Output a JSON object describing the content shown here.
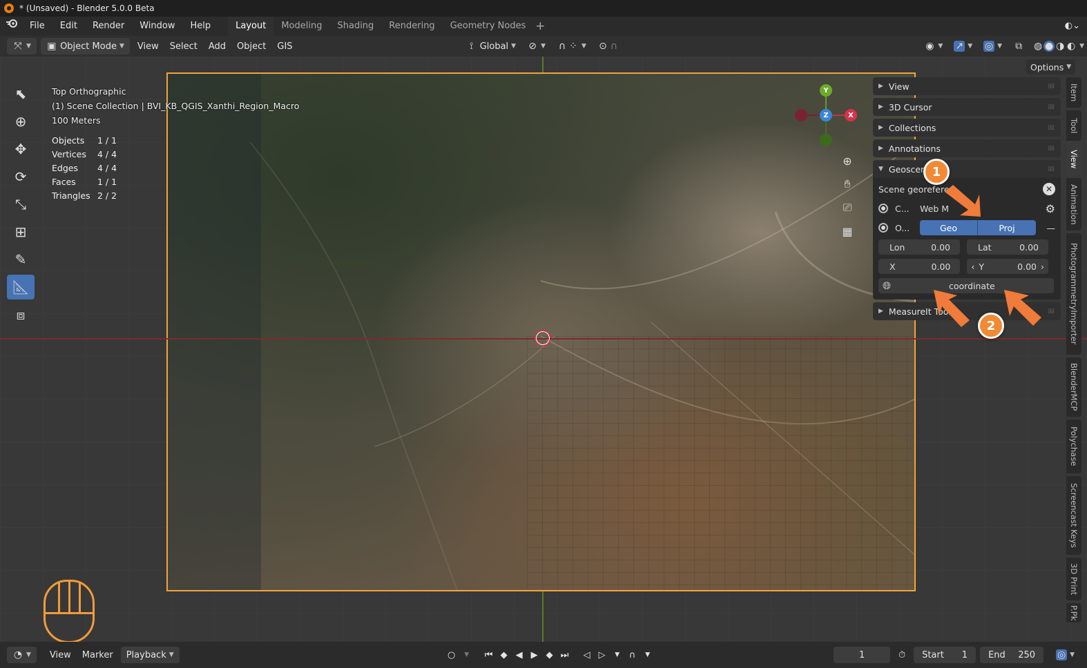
{
  "window": {
    "title": "* (Unsaved) - Blender 5.0.0 Beta"
  },
  "menu": {
    "items": [
      "File",
      "Edit",
      "Render",
      "Window",
      "Help"
    ]
  },
  "workspaces": {
    "tabs": [
      "Layout",
      "Modeling",
      "Shading",
      "Rendering",
      "Geometry Nodes"
    ],
    "active": "Layout",
    "add": "+"
  },
  "header": {
    "mode": "Object Mode",
    "menus": [
      "View",
      "Select",
      "Add",
      "Object",
      "GIS"
    ],
    "orientation": "Global",
    "options_label": "Options"
  },
  "viewport": {
    "view_name": "Top Orthographic",
    "collection": "(1) Scene Collection | BVI_KB_QGIS_Xanthi_Region_Macro",
    "scale": "100 Meters",
    "stats": [
      {
        "label": "Objects",
        "value": "1 / 1"
      },
      {
        "label": "Vertices",
        "value": "4 / 4"
      },
      {
        "label": "Edges",
        "value": "4 / 4"
      },
      {
        "label": "Faces",
        "value": "1 / 1"
      },
      {
        "label": "Triangles",
        "value": "2 / 2"
      }
    ],
    "gizmo": {
      "x": "X",
      "y": "Y",
      "z": "Z"
    }
  },
  "npanel": {
    "sections": [
      "View",
      "3D Cursor",
      "Collections",
      "Annotations"
    ],
    "geoscene": {
      "title": "Geoscen",
      "scene_label": "Scene georeferen",
      "crs_short": "C...",
      "crs_value": "Web M",
      "origin_short": "O...",
      "geo_button": "Geo",
      "proj_button": "Proj",
      "lon_label": "Lon",
      "lon_value": "0.00",
      "lat_label": "Lat",
      "lat_value": "0.00",
      "x_label": "X",
      "x_value": "0.00",
      "y_label": "Y",
      "y_value": "0.00",
      "coord_label": "coordinate"
    },
    "last_section": "MeasureIt Tools"
  },
  "sidetabs": [
    "Item",
    "Tool",
    "View",
    "Animation",
    "PhotogrammetryImporter",
    "BlenderMCP",
    "Polychase",
    "Screencast Keys",
    "3D Print",
    "P.Pk"
  ],
  "annotations": {
    "badge1": "1",
    "badge2": "2"
  },
  "timeline": {
    "menus": [
      "View",
      "Marker",
      "Playback"
    ],
    "current_frame": "1",
    "start_label": "Start",
    "start_value": "1",
    "end_label": "End",
    "end_value": "250"
  },
  "colors": {
    "accent": "#4772b3",
    "selection": "#f3a43a",
    "annotation": "#f08a35"
  }
}
